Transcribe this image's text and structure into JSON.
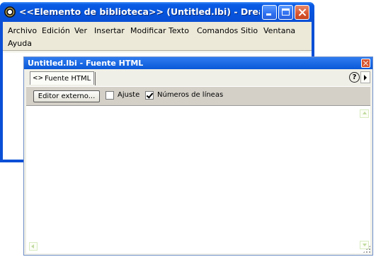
{
  "main_window": {
    "title": "<<Elemento de biblioteca>> (Untitled.lbi) - Dreamw...",
    "menu": [
      "Archivo",
      "Edición",
      "Ver",
      "Insertar",
      "Modificar",
      "Texto",
      "Comandos",
      "Sitio",
      "Ventana",
      "Ayuda"
    ]
  },
  "source_panel": {
    "title": "Untitled.lbi - Fuente HTML",
    "tab_label": "Fuente HTML",
    "help_label": "?",
    "toolbar": {
      "editor_button": "Editor externo...",
      "wrap_label": "Ajuste",
      "wrap_checked": false,
      "line_numbers_label": "Números de líneas",
      "line_numbers_checked": true
    }
  },
  "colors": {
    "title_blue": "#0a58d8",
    "close_red": "#d8552f",
    "face": "#ece9d8",
    "toolbar": "#d4d0c8"
  }
}
